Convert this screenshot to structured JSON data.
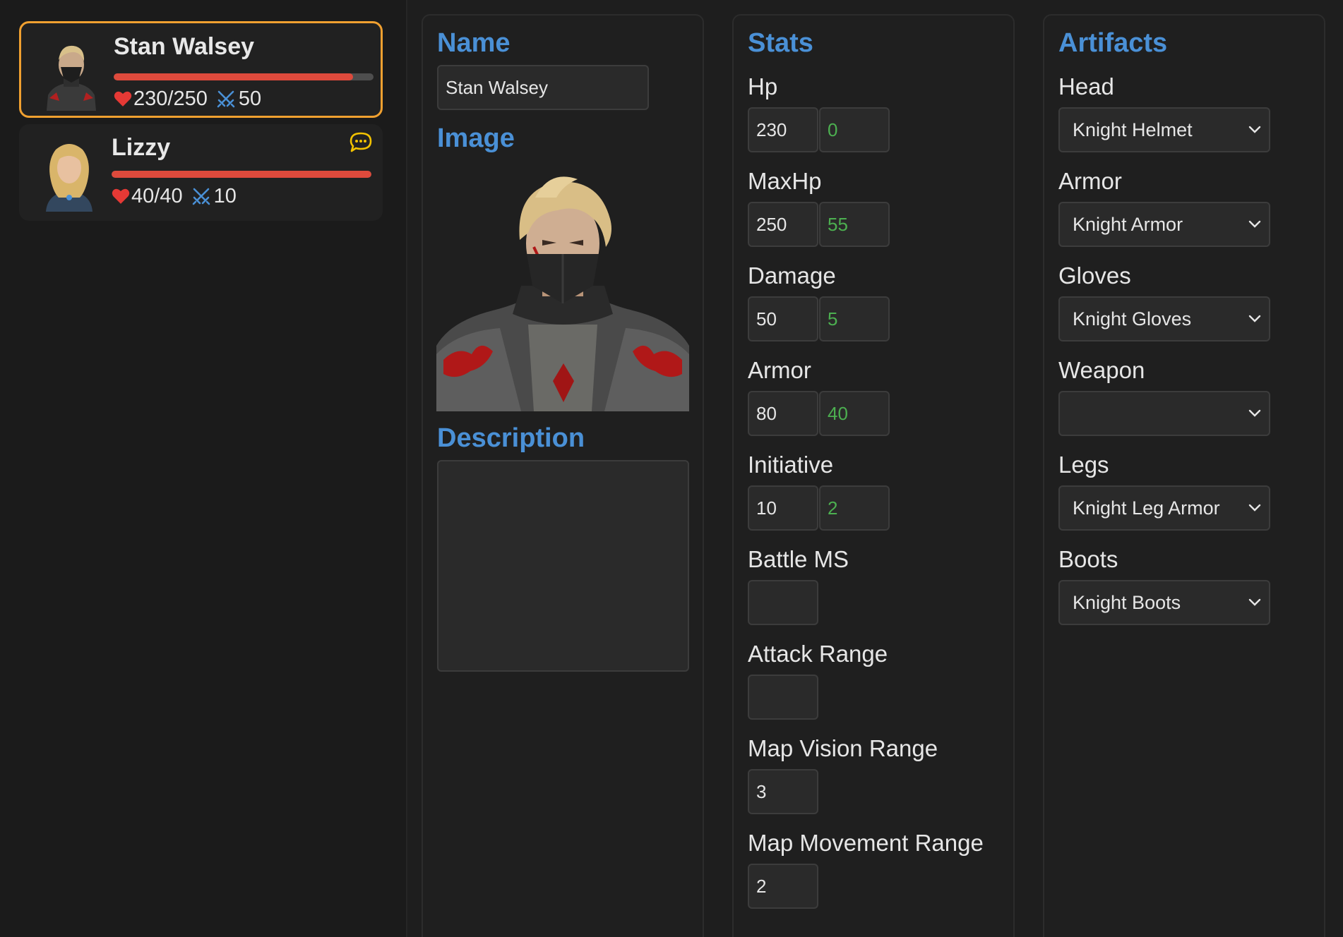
{
  "characters": [
    {
      "name": "Stan Walsey",
      "hp_text": "230/250",
      "hp_fraction": 0.92,
      "damage": "50",
      "selected": true
    },
    {
      "name": "Lizzy",
      "hp_text": "40/40",
      "hp_fraction": 1.0,
      "damage": "10",
      "selected": false
    }
  ],
  "details": {
    "name_title": "Name",
    "name_value": "Stan Walsey",
    "image_title": "Image",
    "description_title": "Description",
    "description_value": ""
  },
  "stats": {
    "title": "Stats",
    "hp_label": "Hp",
    "hp_base": "230",
    "hp_bonus": "0",
    "maxhp_label": "MaxHp",
    "maxhp_base": "250",
    "maxhp_bonus": "55",
    "damage_label": "Damage",
    "damage_base": "50",
    "damage_bonus": "5",
    "armor_label": "Armor",
    "armor_base": "80",
    "armor_bonus": "40",
    "initiative_label": "Initiative",
    "initiative_base": "10",
    "initiative_bonus": "2",
    "battle_ms_label": "Battle MS",
    "battle_ms_value": "",
    "attack_range_label": "Attack Range",
    "attack_range_value": "",
    "map_vision_label": "Map Vision Range",
    "map_vision_value": "3",
    "map_movement_label": "Map Movement Range",
    "map_movement_value": "2"
  },
  "artifacts": {
    "title": "Artifacts",
    "head_label": "Head",
    "head_value": "Knight Helmet",
    "armor_label": "Armor",
    "armor_value": "Knight Armor",
    "gloves_label": "Gloves",
    "gloves_value": "Knight Gloves",
    "weapon_label": "Weapon",
    "weapon_value": "",
    "legs_label": "Legs",
    "legs_value": "Knight Leg Armor",
    "boots_label": "Boots",
    "boots_value": "Knight Boots"
  },
  "colors": {
    "accent_blue": "#4a90d6",
    "selected_border": "#f0a030",
    "hp_bar": "#de4a3c",
    "bonus_green": "#4caf50",
    "chat_icon": "#f2c200"
  },
  "icons": [
    "heart-icon",
    "crossed-swords-icon",
    "chat-bubble-icon",
    "chevron-down-icon"
  ]
}
